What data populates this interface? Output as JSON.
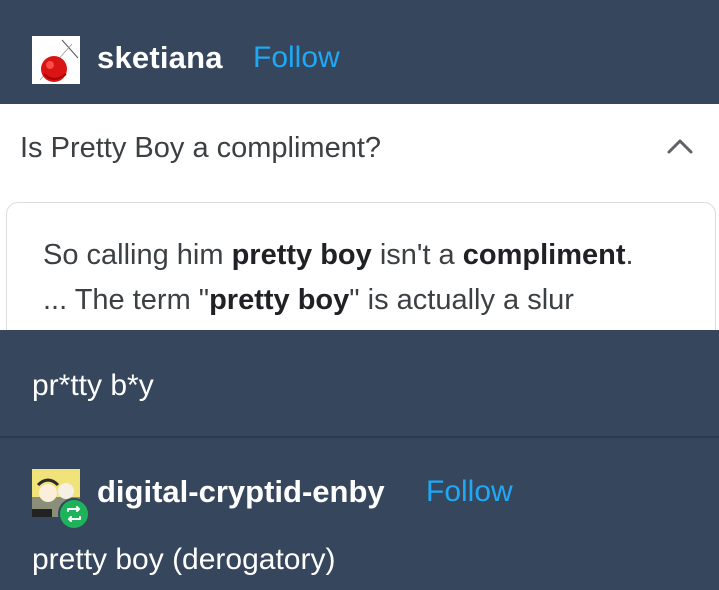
{
  "post": {
    "author": "sketiana",
    "follow_label": "Follow",
    "avatar_icon": "red-ball-avatar-icon"
  },
  "embedded_screenshot": {
    "question": "Is Pretty Boy a compliment?",
    "chevron_icon": "chevron-up-icon",
    "snippet": {
      "line1_a": "So calling him ",
      "line1_b": "pretty boy",
      "line1_c": " isn't a ",
      "line1_d": "compliment",
      "line1_e": ".",
      "line2_a": "... The term \"",
      "line2_b": "pretty boy",
      "line2_c": "\" is actually a slur"
    }
  },
  "reblog_comment": "pr*tty b*y",
  "reblog": {
    "author": "digital-cryptid-enby",
    "follow_label": "Follow",
    "avatar_icon": "cartoon-avatar-icon",
    "badge_icon": "reblog-icon",
    "text": "pretty boy (derogatory)"
  },
  "colors": {
    "background": "#36465d",
    "follow": "#1fa9f5",
    "reblog_badge": "#1eb35a"
  }
}
